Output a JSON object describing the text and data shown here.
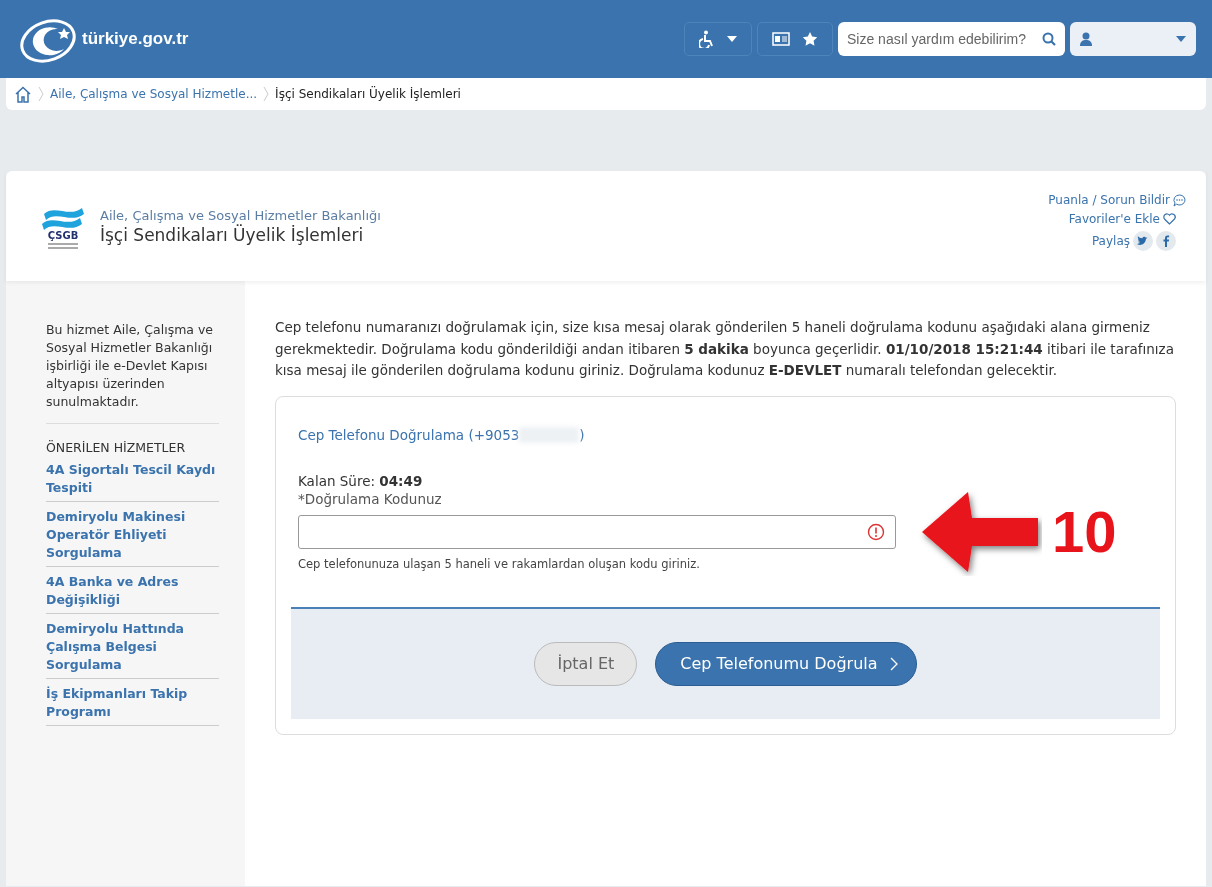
{
  "header": {
    "logo": "türkiye.gov.tr",
    "search": {
      "placeholder": "Size nasıl yardım edebilirim?"
    }
  },
  "breadcrumb": [
    "Aile, Çalışma ve Sosyal Hizmetle...",
    "İşçi Sendikaları Üyelik İşlemleri"
  ],
  "service": {
    "logo_text": "ÇSGB",
    "ministry": "Aile, Çalışma ve Sosyal Hizmetler Bakanlığı",
    "title": "İşçi Sendikaları Üyelik İşlemleri",
    "actions": [
      {
        "kind": "feedback",
        "label": "Puanla / Sorun Bildir"
      },
      {
        "kind": "favorite",
        "label": "Favoriler'e Ekle"
      },
      {
        "kind": "share",
        "label": "Paylaş"
      }
    ]
  },
  "sidebar": {
    "about": "Bu hizmet Aile, Çalışma ve Sosyal Hizmetler Bakanlığı işbirliği ile e-Devlet Kapısı altyapısı üzerinden sunulmaktadır.",
    "heading": "ÖNERİLEN HİZMETLER",
    "links": [
      "4A Sigortalı Tescil Kaydı Tespiti",
      "Demiryolu Makinesi Operatör Ehliyeti Sorgulama",
      "4A Banka ve Adres Değişikliği",
      "Demiryolu Hattında Çalışma Belgesi Sorgulama",
      "İş Ekipmanları Takip Programı"
    ]
  },
  "intro": "Cep telefonu numaranızı doğrulamak için, size kısa mesaj olarak gönderilen 5 haneli doğrulama kodunu aşağıdaki alana girmeniz gerekmektedir. Doğrulama kodu gönderildiği andan itibaren **5 dakika** boyunca geçerlidir. **01/10/2018 15:21:44** itibari ile tarafınıza kısa mesaj ile gönderilen doğrulama kodunu giriniz. Doğrulama kodunuz **E-DEVLET** numaralı telefondan gelecektir.",
  "form": {
    "title_start": "Cep Telefonu Doğrulama (+9053",
    "title_end": ")",
    "timer_label": "Kalan Süre:",
    "timer": "04:49",
    "field_label": "*Doğrulama Kodunuz",
    "error": true,
    "help": "Cep telefonunuza ulaşan 5 haneli ve rakamlardan oluşan kodu giriniz.",
    "buttons": [
      {
        "kind": "secondary",
        "label": "İptal Et"
      },
      {
        "kind": "primary",
        "label": "Cep Telefonumu Doğrula"
      }
    ]
  },
  "annotation": {
    "label": "10"
  }
}
